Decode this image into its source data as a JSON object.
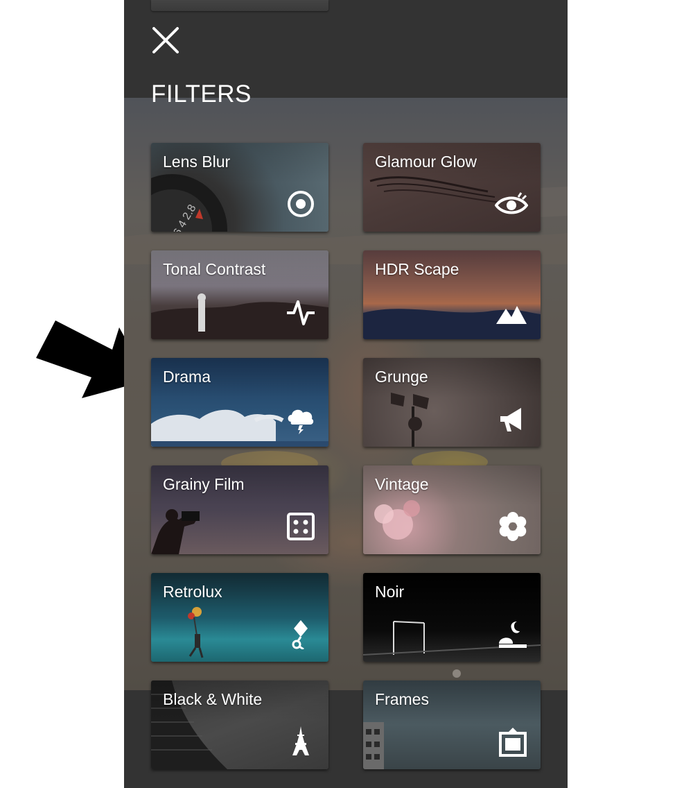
{
  "panel": {
    "title": "FILTERS",
    "close_icon": "close-icon"
  },
  "filters": [
    {
      "label": "Lens Blur",
      "icon": "target-circle-icon"
    },
    {
      "label": "Glamour Glow",
      "icon": "eye-icon"
    },
    {
      "label": "Tonal Contrast",
      "icon": "pulse-icon"
    },
    {
      "label": "HDR Scape",
      "icon": "mountains-icon"
    },
    {
      "label": "Drama",
      "icon": "storm-cloud-icon"
    },
    {
      "label": "Grunge",
      "icon": "megaphone-icon"
    },
    {
      "label": "Grainy Film",
      "icon": "dice-icon"
    },
    {
      "label": "Vintage",
      "icon": "flower-icon"
    },
    {
      "label": "Retrolux",
      "icon": "balloon-icon"
    },
    {
      "label": "Noir",
      "icon": "moon-horizon-icon"
    },
    {
      "label": "Black & White",
      "icon": "eiffel-tower-icon"
    },
    {
      "label": "Frames",
      "icon": "frame-icon"
    }
  ],
  "annotation": {
    "arrow_icon": "pointer-arrow-icon",
    "points_to": "Drama"
  },
  "colors": {
    "panel": "#333333",
    "text": "#ffffff",
    "arrow": "#000000"
  }
}
